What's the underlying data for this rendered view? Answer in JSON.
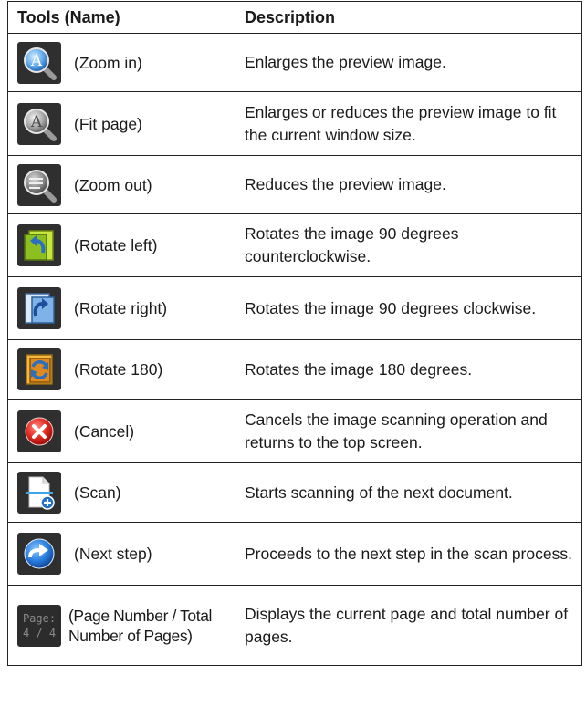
{
  "table": {
    "headers": {
      "name": "Tools (Name)",
      "description": "Description"
    },
    "rows": [
      {
        "name": "(Zoom in)",
        "icon": "zoom-in-icon",
        "description": "Enlarges the preview image."
      },
      {
        "name": "(Fit page)",
        "icon": "fit-page-icon",
        "description": "Enlarges or reduces the preview image to fit the current window size."
      },
      {
        "name": "(Zoom out)",
        "icon": "zoom-out-icon",
        "description": "Reduces the preview image."
      },
      {
        "name": "(Rotate left)",
        "icon": "rotate-left-icon",
        "description": "Rotates the image 90 degrees counterclockwise."
      },
      {
        "name": "(Rotate right)",
        "icon": "rotate-right-icon",
        "description": "Rotates the image 90 degrees clockwise."
      },
      {
        "name": "(Rotate 180)",
        "icon": "rotate-180-icon",
        "description": "Rotates the image 180 degrees."
      },
      {
        "name": "(Cancel)",
        "icon": "cancel-icon",
        "description": "Cancels the image scanning operation and returns to the top screen."
      },
      {
        "name": "(Scan)",
        "icon": "scan-icon",
        "description": "Starts scanning of the next document."
      },
      {
        "name": "(Next step)",
        "icon": "next-step-icon",
        "description": "Proceeds to the next step in the scan process."
      },
      {
        "name": "(Page Number / Total Number of Pages)",
        "icon": "page-number-icon",
        "description": "Displays the current page and total number of pages."
      }
    ]
  },
  "page_icon": {
    "label": "Page:",
    "value": "4 / 4"
  }
}
